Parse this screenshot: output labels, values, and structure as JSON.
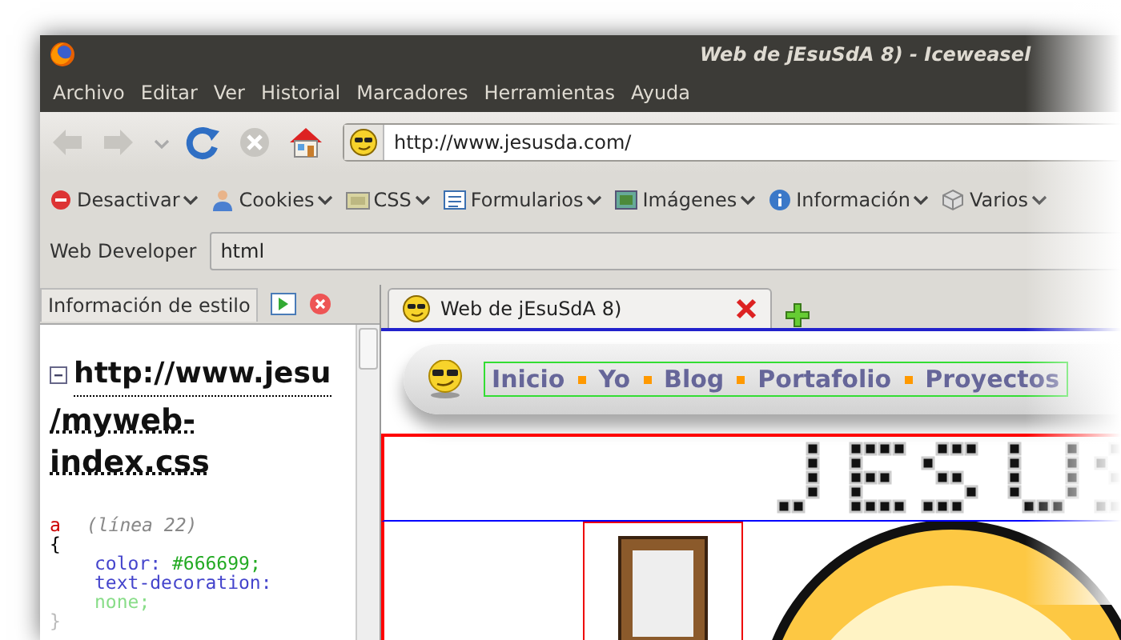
{
  "window": {
    "title": "Web de jEsuSdA 8) - Iceweasel"
  },
  "menu": [
    "Archivo",
    "Editar",
    "Ver",
    "Historial",
    "Marcadores",
    "Herramientas",
    "Ayuda"
  ],
  "navigation": {
    "buttons": [
      {
        "kind": "back",
        "disabled": true
      },
      {
        "kind": "forward",
        "disabled": true
      },
      {
        "kind": "history",
        "disabled": true
      },
      {
        "kind": "reload",
        "disabled": false
      },
      {
        "kind": "stop",
        "disabled": true
      },
      {
        "kind": "home",
        "disabled": false
      }
    ],
    "url": "http://www.jesusda.com/"
  },
  "web_developer_toolbar": [
    {
      "kind": "disable",
      "label": "Desactivar"
    },
    {
      "kind": "cookies",
      "label": "Cookies"
    },
    {
      "kind": "css",
      "label": "CSS"
    },
    {
      "kind": "forms",
      "label": "Formularios"
    },
    {
      "kind": "images",
      "label": "Imágenes"
    },
    {
      "kind": "info",
      "label": "Información"
    },
    {
      "kind": "misc",
      "label": "Varios"
    }
  ],
  "web_developer_bar": {
    "label": "Web Developer",
    "value": "html"
  },
  "sidebar": {
    "title": "Información de estilo",
    "stylesheet": {
      "expanded": true,
      "url_line_1": "http://www.jesu",
      "url_line_2": "/myweb-index.css"
    },
    "rule": {
      "selector": "a",
      "line": "(línea 22)",
      "open": "{",
      "declarations": [
        {
          "property": "color:",
          "value": "#666699;"
        },
        {
          "property": "text-decoration:",
          "value": "none;"
        }
      ],
      "close": "}"
    }
  },
  "tabs": [
    {
      "label": "Web de jEsuSdA 8)",
      "selected": true
    }
  ],
  "page": {
    "nav": [
      "Inicio",
      "Yo",
      "Blog",
      "Portafolio",
      "Proyectos"
    ]
  }
}
